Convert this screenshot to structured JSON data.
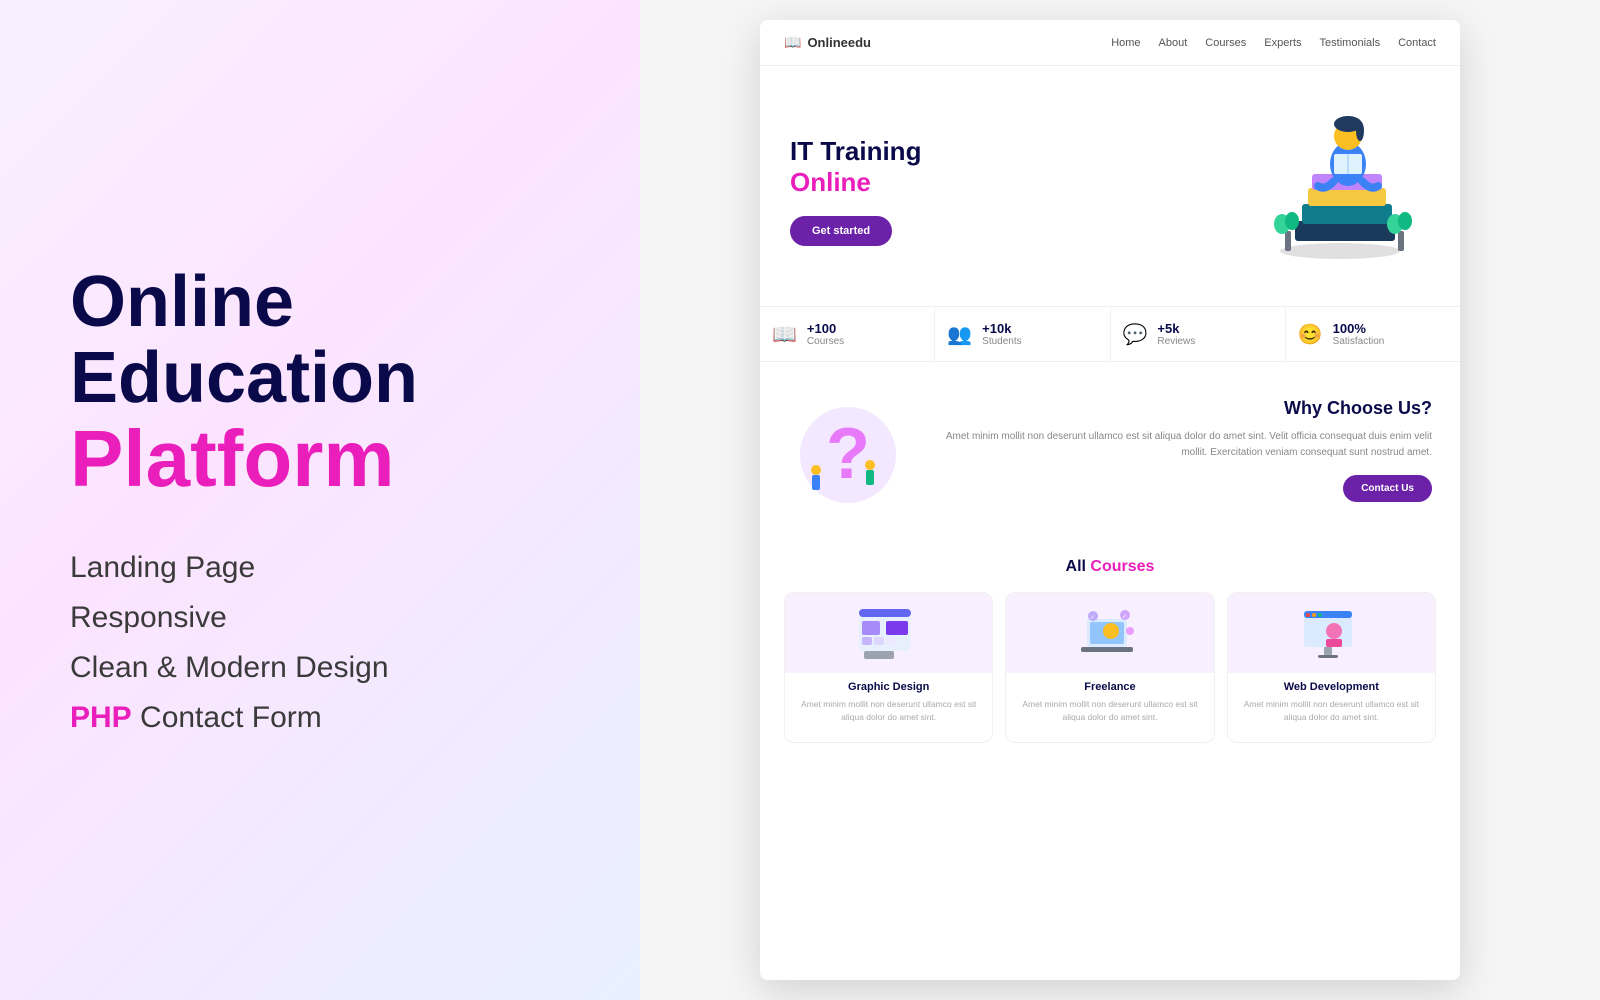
{
  "left": {
    "title_line1": "Online",
    "title_line2": "Education",
    "title_line3": "Platform",
    "features": [
      {
        "text": "Landing Page",
        "has_pink": false
      },
      {
        "text": "Responsive",
        "has_pink": false
      },
      {
        "text": "Clean & Modern Design",
        "has_pink": false
      },
      {
        "text": "PHP Contact Form",
        "has_pink": true,
        "pink_word": "PHP",
        "rest": " Contact Form"
      }
    ]
  },
  "website": {
    "nav": {
      "logo": "Onlineedu",
      "links": [
        "Home",
        "About",
        "Courses",
        "Experts",
        "Testimonials",
        "Contact"
      ]
    },
    "hero": {
      "title": "IT Training",
      "subtitle": "Online",
      "btn_label": "Get started"
    },
    "stats": [
      {
        "icon": "📖",
        "num": "+100",
        "label": "Courses"
      },
      {
        "icon": "👥",
        "num": "+10k",
        "label": "Students"
      },
      {
        "icon": "💬",
        "num": "+5k",
        "label": "Reviews"
      },
      {
        "icon": "😊",
        "num": "100%",
        "label": "Satisfaction"
      }
    ],
    "why": {
      "title": "Why Choose Us?",
      "desc": "Amet minim mollit non deserunt ullamco est sit aliqua dolor do amet sint. Velit officia consequat duis enim velit mollit. Exercitation veniam consequat sunt nostrud amet.",
      "btn_label": "Contact Us"
    },
    "courses": {
      "heading_part1": "All ",
      "heading_part2": "Courses",
      "cards": [
        {
          "title": "Graphic Design",
          "desc": "Amet minim mollit non deserunt ullamco est sit aliqua dolor do amet sint."
        },
        {
          "title": "Freelance",
          "desc": "Amet minim mollit non deserunt ullamco est sit aliqua dolor do amet sint."
        },
        {
          "title": "Web Development",
          "desc": "Amet minim mollit non deserunt ullamco est sit aliqua dolor do amet sint."
        }
      ]
    }
  }
}
